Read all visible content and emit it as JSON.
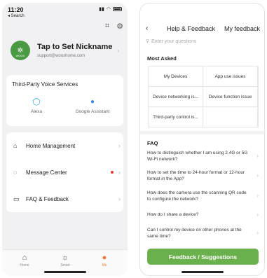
{
  "left": {
    "status": {
      "time": "11:20",
      "back_app": "◂ Search"
    },
    "profile": {
      "avatar_brand": "WOOX",
      "nickname": "Tap to Set Nickname",
      "email": "support@wooxhome.com"
    },
    "voice": {
      "title": "Third-Party Voice Services",
      "services": [
        {
          "label": "Alexa",
          "icon": "alexa-ring-icon"
        },
        {
          "label": "Google Assistant",
          "icon": "google-assistant-icon"
        }
      ]
    },
    "menu": [
      {
        "label": "Home Management",
        "icon": "home-outline-icon"
      },
      {
        "label": "Message Center",
        "icon": "chat-bubble-icon"
      },
      {
        "label": "FAQ & Feedback",
        "icon": "book-icon"
      }
    ],
    "tabs": [
      {
        "label": "Home",
        "icon": "home-icon"
      },
      {
        "label": "Smart",
        "icon": "sun-icon"
      },
      {
        "label": "Me",
        "icon": "person-icon",
        "active": true
      }
    ],
    "colors": {
      "accent_green": "#4a9a44",
      "tab_active": "#e87b3a",
      "badge_red": "#e53935"
    }
  },
  "right": {
    "nav": {
      "title": "Help & Feedback",
      "link": "My feedback"
    },
    "search": {
      "placeholder": "Enter your questions"
    },
    "most_asked": {
      "title": "Most Asked",
      "cells": [
        "My Devices",
        "App use issues",
        "Device networking is...",
        "Device function issue",
        "Third-party control is...",
        ""
      ]
    },
    "faq": {
      "title": "FAQ",
      "items": [
        "How to distinguish whether I am using 2.4G or 5G Wi-Fi network?",
        "How to set the time to 24-hour format or 12-hour format in the App?",
        "How does the camera use the scanning QR code to configure the network?",
        "How do I share a device?",
        "Can I control my device on other phones at the same time?"
      ]
    },
    "feedback_button": "Feedback / Suggestions",
    "colors": {
      "button_green": "#6ab04c"
    }
  }
}
